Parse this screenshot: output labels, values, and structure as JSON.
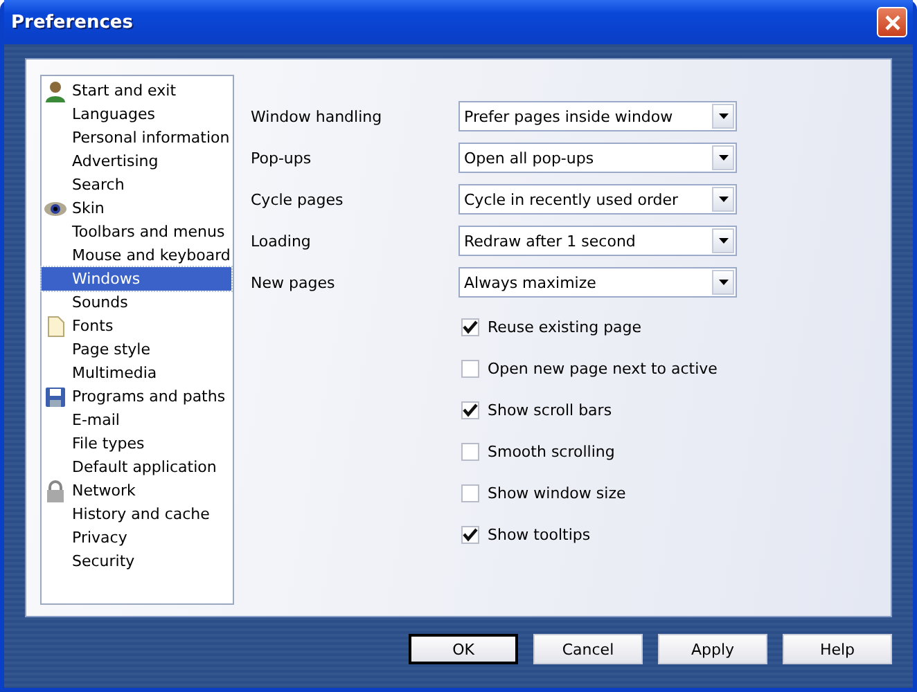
{
  "window": {
    "title": "Preferences"
  },
  "sidebar": {
    "items": [
      {
        "label": "Start and exit",
        "kind": "section",
        "selected": false
      },
      {
        "label": "Languages",
        "kind": "page",
        "selected": false
      },
      {
        "label": "Personal information",
        "kind": "page",
        "selected": false
      },
      {
        "label": "Advertising",
        "kind": "page",
        "selected": false
      },
      {
        "label": "Search",
        "kind": "page",
        "selected": false
      },
      {
        "label": "Skin",
        "kind": "section",
        "selected": false
      },
      {
        "label": "Toolbars and menus",
        "kind": "page",
        "selected": false
      },
      {
        "label": "Mouse and keyboard",
        "kind": "page",
        "selected": false
      },
      {
        "label": "Windows",
        "kind": "page",
        "selected": true
      },
      {
        "label": "Sounds",
        "kind": "page",
        "selected": false
      },
      {
        "label": "Fonts",
        "kind": "section",
        "selected": false
      },
      {
        "label": "Page style",
        "kind": "page",
        "selected": false
      },
      {
        "label": "Multimedia",
        "kind": "page",
        "selected": false
      },
      {
        "label": "Programs and paths",
        "kind": "section",
        "selected": false
      },
      {
        "label": "E-mail",
        "kind": "page",
        "selected": false
      },
      {
        "label": "File types",
        "kind": "page",
        "selected": false
      },
      {
        "label": "Default application",
        "kind": "page",
        "selected": false
      },
      {
        "label": "Network",
        "kind": "section",
        "selected": false
      },
      {
        "label": "History and cache",
        "kind": "page",
        "selected": false
      },
      {
        "label": "Privacy",
        "kind": "page",
        "selected": false
      },
      {
        "label": "Security",
        "kind": "page",
        "selected": false
      }
    ]
  },
  "settings": [
    {
      "label": "Window handling",
      "value": "Prefer pages inside window"
    },
    {
      "label": "Pop-ups",
      "value": "Open all pop-ups"
    },
    {
      "label": "Cycle pages",
      "value": "Cycle in recently used order"
    },
    {
      "label": "Loading",
      "value": "Redraw after 1 second"
    },
    {
      "label": "New pages",
      "value": "Always maximize"
    }
  ],
  "options": [
    {
      "label": "Reuse existing page",
      "checked": true
    },
    {
      "label": "Open new page next to active",
      "checked": false
    },
    {
      "label": "Show scroll bars",
      "checked": true
    },
    {
      "label": "Smooth scrolling",
      "checked": false
    },
    {
      "label": "Show window size",
      "checked": false
    },
    {
      "label": "Show tooltips",
      "checked": true
    }
  ],
  "buttons": [
    {
      "label": "OK",
      "default": true
    },
    {
      "label": "Cancel",
      "default": false
    },
    {
      "label": "Apply",
      "default": false
    },
    {
      "label": "Help",
      "default": false
    }
  ]
}
